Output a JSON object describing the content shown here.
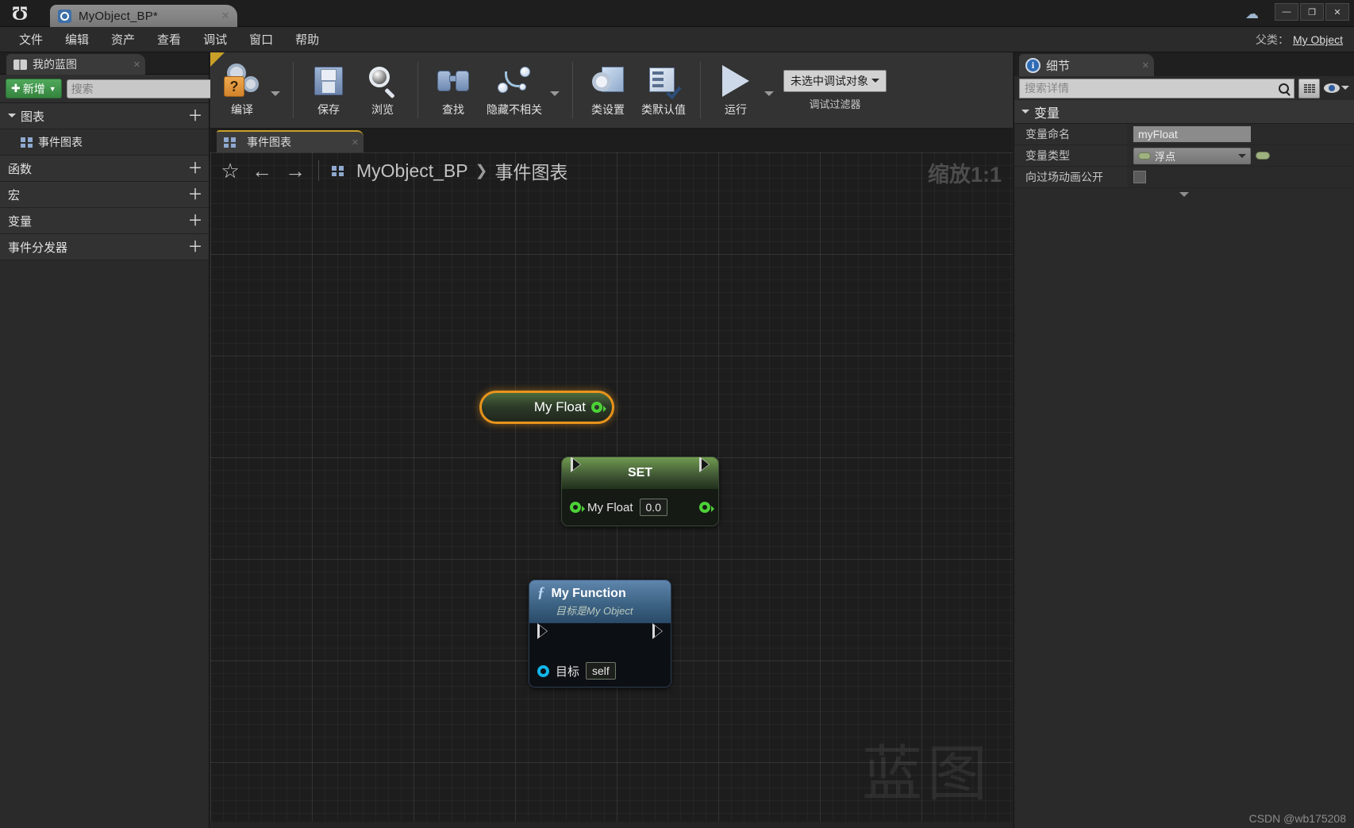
{
  "window": {
    "tab_title": "MyObject_BP*",
    "minimize": "—",
    "maximize": "❐",
    "close": "✕",
    "tab_close": "✕"
  },
  "menubar": {
    "items": [
      "文件",
      "编辑",
      "资产",
      "查看",
      "调试",
      "窗口",
      "帮助"
    ],
    "parent_label": "父类：",
    "parent_value": "My Object"
  },
  "toolbar": {
    "compile": "编译",
    "save": "保存",
    "browse": "浏览",
    "find": "查找",
    "hide_unrelated": "隐藏不相关",
    "class_settings": "类设置",
    "class_defaults": "类默认值",
    "play": "运行",
    "debug_object": "未选中调试对象",
    "debug_filter": "调试过滤器"
  },
  "my_blueprint": {
    "tab_label": "我的蓝图",
    "tab_close": "✕",
    "add_button": "新增",
    "add_caret": "▼",
    "search_placeholder": "搜索",
    "search_value": "",
    "sections": [
      {
        "label": "图表",
        "plus": "＋",
        "kind": "root"
      },
      {
        "label": "事件图表",
        "plus": "",
        "kind": "child"
      },
      {
        "label": "函数",
        "plus": "＋",
        "kind": "root-flat"
      },
      {
        "label": "宏",
        "plus": "＋",
        "kind": "root-flat"
      },
      {
        "label": "变量",
        "plus": "＋",
        "kind": "root-flat"
      },
      {
        "label": "事件分发器",
        "plus": "＋",
        "kind": "root-flat"
      }
    ]
  },
  "graph": {
    "tab_label": "事件图表",
    "tab_close": "✕",
    "star": "☆",
    "back": "←",
    "forward": "→",
    "breadcrumb_root": "MyObject_BP",
    "breadcrumb_sep": "❯",
    "breadcrumb_leaf": "事件图表",
    "zoom": "缩放1:1",
    "watermark": "蓝图"
  },
  "nodes": {
    "getter": {
      "label": "My Float"
    },
    "setter": {
      "title": "SET",
      "pin_label": "My Float",
      "value": "0.0"
    },
    "function": {
      "title": "My Function",
      "subtitle_prefix": "目标是",
      "subtitle_target": "My Object",
      "fx": "ƒ",
      "target_label": "目标",
      "target_value": "self"
    }
  },
  "details": {
    "tab_label": "细节",
    "tab_close": "✕",
    "info_glyph": "i",
    "search_placeholder": "搜索详情",
    "search_value": "",
    "section_title": "变量",
    "section_caret": "◢",
    "rows": [
      {
        "name": "变量命名",
        "value": "myFloat",
        "kind": "text"
      },
      {
        "name": "变量类型",
        "value": "浮点",
        "kind": "combo"
      },
      {
        "name": "向过场动画公开",
        "value": "",
        "kind": "checkbox"
      }
    ]
  },
  "footer": {
    "credit": "CSDN @wb175208"
  },
  "colors": {
    "accent_orange": "#e8941c",
    "exec_white": "#d9d9d9",
    "float_green": "#4cd137",
    "object_blue": "#12b6e8",
    "add_green": "#4fa85a",
    "tab_gold": "#c8a028"
  }
}
